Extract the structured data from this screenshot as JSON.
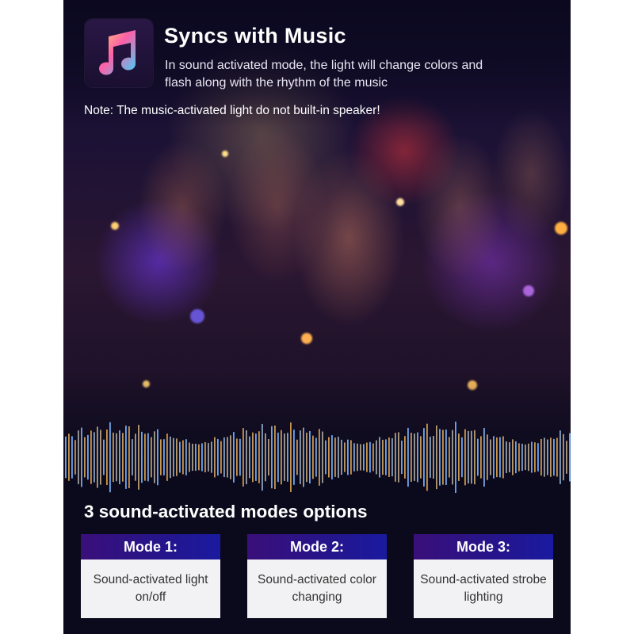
{
  "header": {
    "icon": "music-note-icon",
    "title": "Syncs with Music",
    "description": "In sound activated mode, the light will change colors and flash along with the rhythm of the music"
  },
  "note": "Note: The music-activated light do not built-in speaker!",
  "section_title": "3 sound-activated modes options",
  "modes": [
    {
      "label": "Mode 1:",
      "description": "Sound-activated light on/off"
    },
    {
      "label": "Mode 2:",
      "description": "Sound-activated color changing"
    },
    {
      "label": "Mode 3:",
      "description": "Sound-activated strobe lighting"
    }
  ],
  "colors": {
    "background": "#0b0a1c",
    "mode_header_start": "#3a0f7a",
    "mode_header_end": "#1a1aa0",
    "mode_body": "#f2f2f4"
  }
}
